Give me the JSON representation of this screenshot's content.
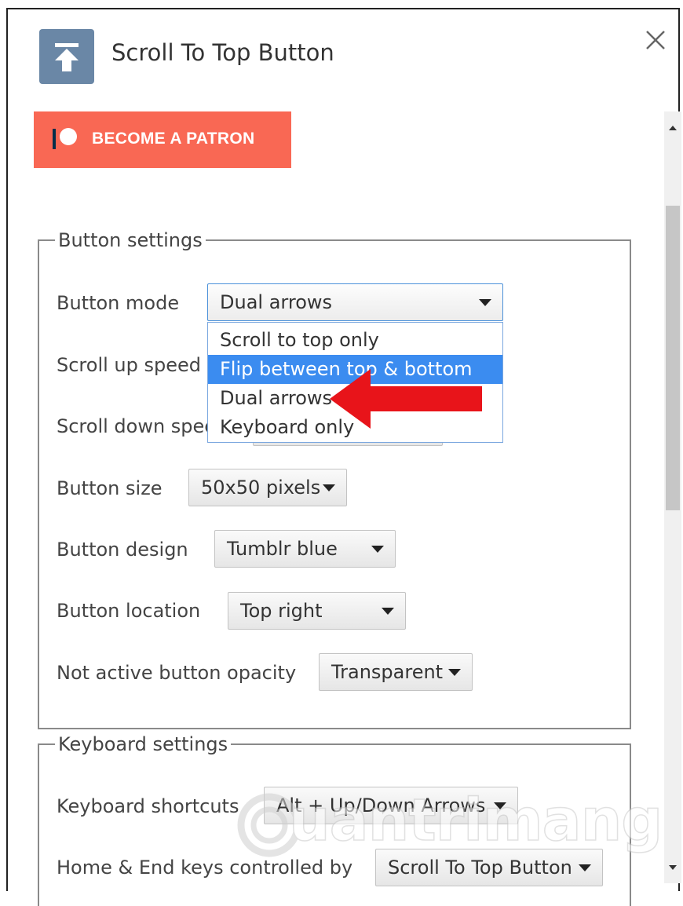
{
  "header": {
    "title": "Scroll To Top Button",
    "icon": "arrow-to-top-icon",
    "icon_color": "#6a87a6"
  },
  "patron_button": {
    "label": "BECOME A PATRON",
    "color": "#f96854"
  },
  "button_settings": {
    "legend": "Button settings",
    "rows": {
      "mode": {
        "label": "Button mode",
        "value": "Dual arrows"
      },
      "scroll_up": {
        "label": "Scroll up speed"
      },
      "scroll_down": {
        "label": "Scroll down spee"
      },
      "size": {
        "label": "Button size",
        "value": "50x50 pixels"
      },
      "design": {
        "label": "Button design",
        "value": "Tumblr blue"
      },
      "location": {
        "label": "Button location",
        "value": "Top right"
      },
      "opacity": {
        "label": "Not active button opacity",
        "value": "Transparent"
      }
    },
    "mode_dropdown": {
      "options": [
        "Scroll to top only",
        "Flip between top & bottom",
        "Dual arrows",
        "Keyboard only"
      ],
      "highlighted_index": 1,
      "highlight_color": "#3b8cf0"
    }
  },
  "keyboard_settings": {
    "legend": "Keyboard settings",
    "rows": {
      "shortcuts": {
        "label": "Keyboard shortcuts",
        "value": "Alt + Up/Down Arrows"
      },
      "home_end": {
        "label": "Home & End keys controlled by",
        "value": "Scroll To Top Button"
      }
    }
  },
  "annotation": {
    "arrow_color": "#e8141a"
  },
  "watermark": {
    "text": "uantrimang"
  }
}
